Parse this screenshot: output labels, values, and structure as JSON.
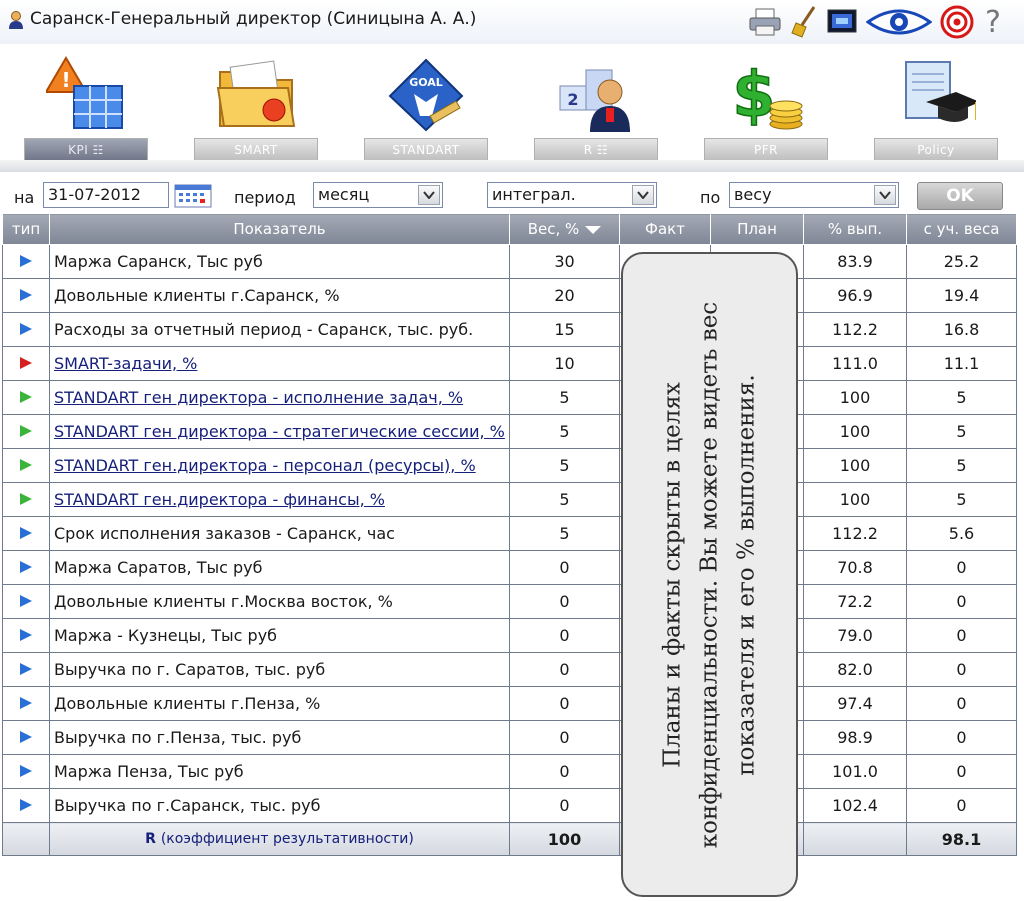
{
  "window": {
    "title": "Саранск-Генеральный директор  (Синицына А. А.)",
    "icons": [
      "print-icon",
      "broom-icon",
      "screen-icon",
      "eye-icon",
      "target-icon",
      "help-icon"
    ],
    "help_glyph": "?"
  },
  "modules": [
    {
      "label": "KPI ☷",
      "icon": "kpi-icon",
      "active": true
    },
    {
      "label": "SMART",
      "icon": "smart-folder-icon",
      "active": false
    },
    {
      "label": "STANDART",
      "icon": "goal-icon",
      "active": false
    },
    {
      "label": "R ☷",
      "icon": "ranking-icon",
      "active": false
    },
    {
      "label": "PFR",
      "icon": "money-icon",
      "active": false
    },
    {
      "label": "Policy",
      "icon": "policy-icon",
      "active": false
    }
  ],
  "filters": {
    "date_label": "на",
    "date_value": "31-07-2012",
    "period_label": "период",
    "period_value": "месяц",
    "mode_value": "интеграл.",
    "sort_label": "по",
    "sort_value": "весу",
    "ok_label": "OK"
  },
  "table": {
    "headers": {
      "type": "тип",
      "indicator": "Показатель",
      "weight": "Вес, %",
      "fact": "Факт",
      "plan": "План",
      "pct": "% вып.",
      "weighted": "с уч. веса"
    },
    "rows": [
      {
        "type": "blue",
        "name": "Маржа Саранск, Тыс руб",
        "link": false,
        "weight": "30",
        "pct": "83.9",
        "weighted": "25.2"
      },
      {
        "type": "blue",
        "name": "Довольные клиенты г.Саранск, %",
        "link": false,
        "weight": "20",
        "pct": "96.9",
        "weighted": "19.4"
      },
      {
        "type": "blue",
        "name": "Расходы за отчетный период - Саранск, тыс. руб.",
        "link": false,
        "weight": "15",
        "pct": "112.2",
        "weighted": "16.8"
      },
      {
        "type": "red",
        "name": "SMART-задачи, %",
        "link": true,
        "weight": "10",
        "pct": "111.0",
        "weighted": "11.1"
      },
      {
        "type": "green",
        "name": "STANDART ген директора - исполнение задач, %",
        "link": true,
        "weight": "5",
        "pct": "100",
        "weighted": "5"
      },
      {
        "type": "green",
        "name": "STANDART ген директора - стратегические сессии, %",
        "link": true,
        "weight": "5",
        "pct": "100",
        "weighted": "5"
      },
      {
        "type": "green",
        "name": "STANDART ген.директора - персонал (ресурсы), %",
        "link": true,
        "weight": "5",
        "pct": "100",
        "weighted": "5"
      },
      {
        "type": "green",
        "name": "STANDART ген.директора - финансы, %",
        "link": true,
        "weight": "5",
        "pct": "100",
        "weighted": "5"
      },
      {
        "type": "blue",
        "name": "Срок исполнения заказов - Саранск, час",
        "link": false,
        "weight": "5",
        "pct": "112.2",
        "weighted": "5.6"
      },
      {
        "type": "blue",
        "name": "Маржа Саратов, Тыс руб",
        "link": false,
        "weight": "0",
        "pct": "70.8",
        "weighted": "0"
      },
      {
        "type": "blue",
        "name": "Довольные клиенты г.Москва восток, %",
        "link": false,
        "weight": "0",
        "pct": "72.2",
        "weighted": "0"
      },
      {
        "type": "blue",
        "name": "Маржа - Кузнецы, Тыс руб",
        "link": false,
        "weight": "0",
        "pct": "79.0",
        "weighted": "0"
      },
      {
        "type": "blue",
        "name": "Выручка по г. Саратов, тыс. руб",
        "link": false,
        "weight": "0",
        "pct": "82.0",
        "weighted": "0"
      },
      {
        "type": "blue",
        "name": "Довольные клиенты г.Пенза, %",
        "link": false,
        "weight": "0",
        "pct": "97.4",
        "weighted": "0"
      },
      {
        "type": "blue",
        "name": "Выручка по г.Пенза, тыс. руб",
        "link": false,
        "weight": "0",
        "pct": "98.9",
        "weighted": "0"
      },
      {
        "type": "blue",
        "name": "Маржа Пенза, Тыс руб",
        "link": false,
        "weight": "0",
        "pct": "101.0",
        "weighted": "0"
      },
      {
        "type": "blue",
        "name": "Выручка по г.Саранск, тыс. руб",
        "link": false,
        "weight": "0",
        "pct": "102.4",
        "weighted": "0"
      }
    ],
    "total": {
      "r_letter": "R",
      "label": "(коэффициент результативности)",
      "weight": "100",
      "weighted": "98.1"
    }
  },
  "overlay": {
    "text": "Планы и факты скрыты в целях конфиденциальности. Вы можете видеть вес показателя и его % выполнения."
  }
}
